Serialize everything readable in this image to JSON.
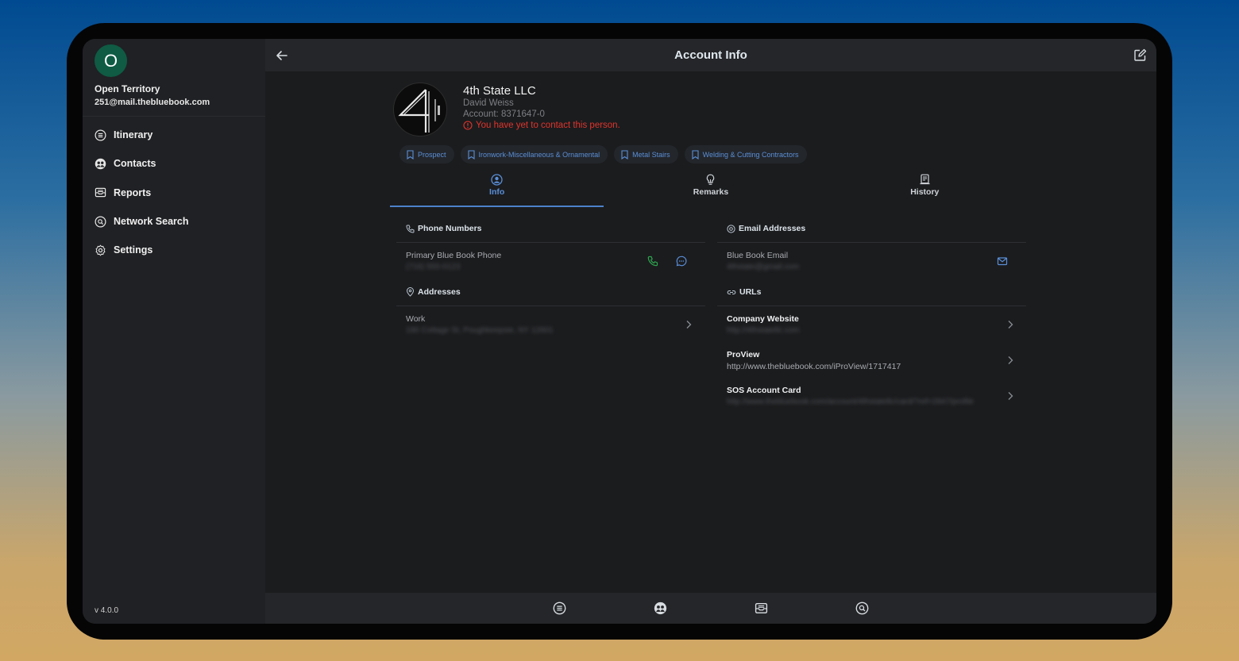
{
  "sidebar": {
    "avatar_initial": "O",
    "user_name": "Open Territory",
    "user_email": "251@mail.thebluebook.com",
    "items": [
      {
        "label": "Itinerary",
        "icon": "list-icon"
      },
      {
        "label": "Contacts",
        "icon": "contacts-icon"
      },
      {
        "label": "Reports",
        "icon": "reports-icon"
      },
      {
        "label": "Network Search",
        "icon": "network-search-icon"
      },
      {
        "label": "Settings",
        "icon": "gear-icon"
      }
    ],
    "version": "v 4.0.0"
  },
  "header": {
    "title": "Account Info",
    "back_icon": "arrow-left-icon",
    "edit_icon": "edit-icon"
  },
  "profile": {
    "company": "4th State LLC",
    "contact": "David Weiss",
    "account": "Account: 8371647-0",
    "warning": "You have yet to contact this person."
  },
  "chips": [
    "Prospect",
    "Ironwork-Miscellaneous & Ornamental",
    "Metal Stairs",
    "Welding & Cutting Contractors"
  ],
  "tabs": [
    {
      "label": "Info",
      "icon": "person-icon",
      "active": true
    },
    {
      "label": "Remarks",
      "icon": "lightbulb-icon",
      "active": false
    },
    {
      "label": "History",
      "icon": "history-icon",
      "active": false
    }
  ],
  "phone": {
    "heading": "Phone Numbers",
    "label": "Primary Blue Book Phone",
    "value": "(716) 555-0123"
  },
  "email": {
    "heading": "Email Addresses",
    "label": "Blue Book Email",
    "value": "4thstate@gmail.com"
  },
  "address": {
    "heading": "Addresses",
    "label": "Work",
    "value": "190 Cottage St, Poughkeepsie, NY 12601"
  },
  "urls": {
    "heading": "URLs",
    "items": [
      {
        "label": "Company Website",
        "value": "http://4thstatellc.com"
      },
      {
        "label": "ProView",
        "value": "http://www.thebluebook.com/iProView/1717417"
      },
      {
        "label": "SOS Account Card",
        "value": "http://www.thebluebook.com/account/4thstatellc/card/?ref=2847/profile"
      }
    ]
  },
  "colors": {
    "accent": "#4d82cc",
    "warning": "#e0342c",
    "phone_green": "#2ea44f",
    "avatar": "#0f5b44"
  }
}
